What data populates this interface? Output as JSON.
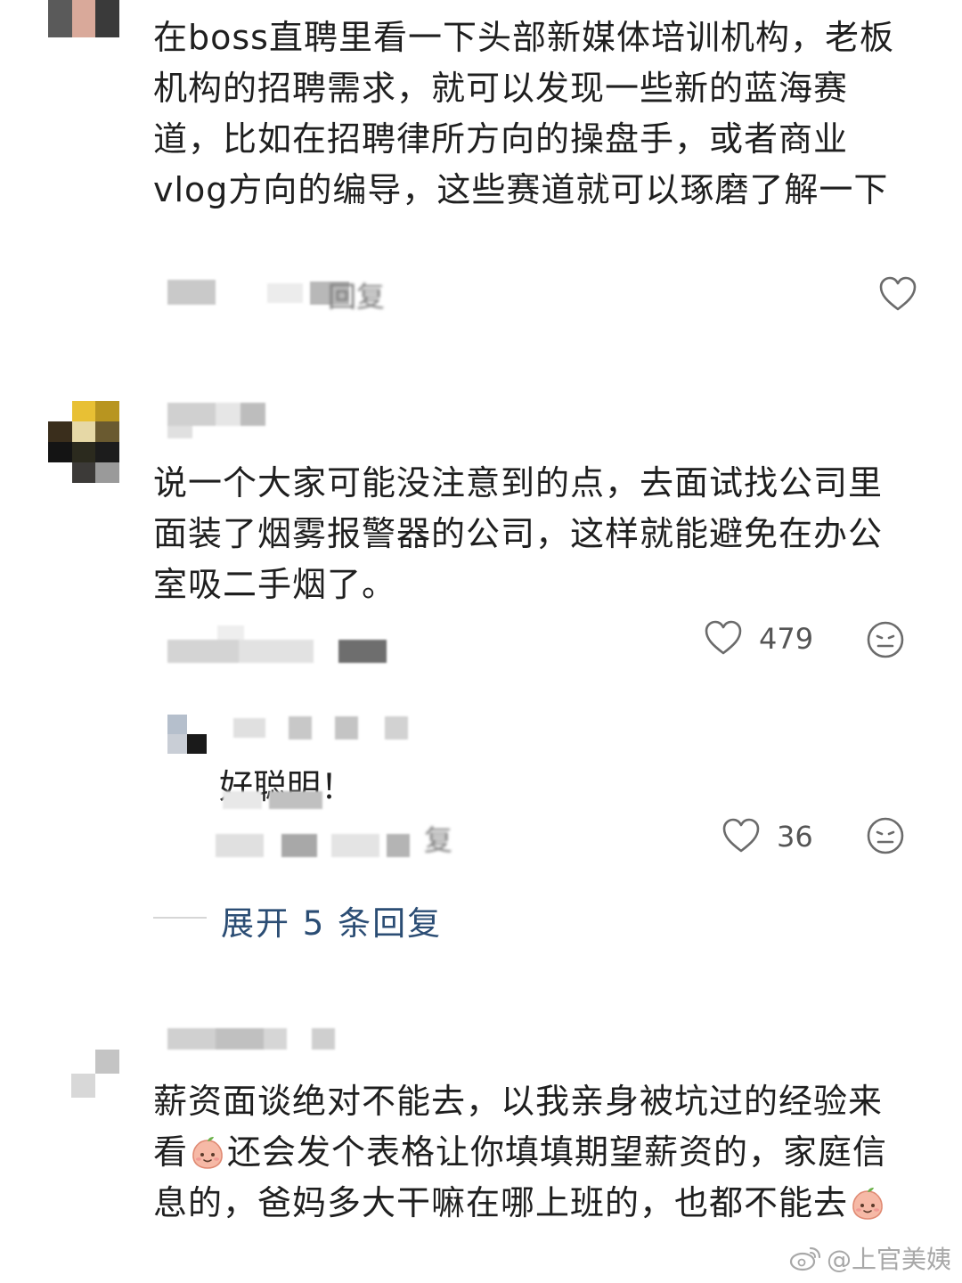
{
  "comments": [
    {
      "text": "在boss直聘里看一下头部新媒体培训机构，老板机构的招聘需求，就可以发现一些新的蓝海赛道，比如在招聘律所方向的操盘手，或者商业vlog方向的编导，这些赛道就可以琢磨了解一下",
      "reply_label": "回复",
      "likes": ""
    },
    {
      "text": "说一个大家可能没注意到的点，去面试找公司里面装了烟雾报警器的公司，这样就能避免在办公室吸二手烟了。",
      "likes": "479",
      "replies": [
        {
          "text": "好聪明！",
          "likes": "36",
          "reply_label": "复"
        }
      ],
      "expand_label": "展开 5 条回复"
    },
    {
      "text_parts": [
        "薪资面谈绝对不能去，以我亲身被坑过的经验来看",
        "还会发个表格让你填填期望薪资的，家庭信息的，爸妈多大干嘛在哪上班的，也都不能去"
      ]
    }
  ],
  "watermark": "@上官美姨",
  "colors": {
    "link": "#2b4d74",
    "text": "#1f1f1f",
    "muted": "#555555"
  },
  "icons": [
    "heart-icon",
    "dislike-face-icon",
    "peach-emoji-icon",
    "weibo-logo-icon"
  ]
}
